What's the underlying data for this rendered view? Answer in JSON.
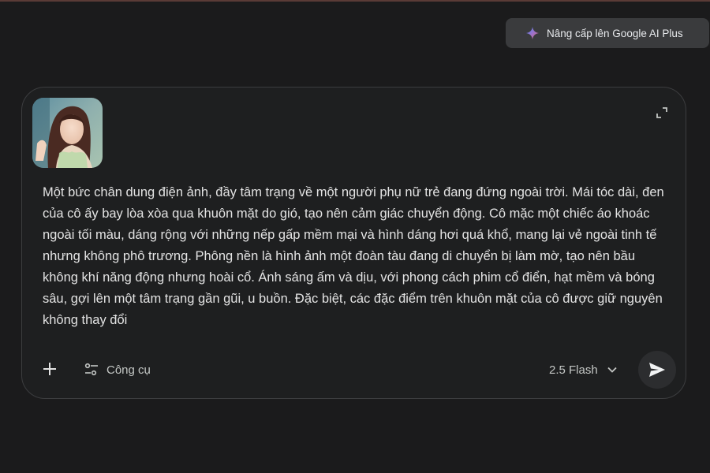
{
  "header": {
    "upgrade_label": "Nâng cấp lên Google AI Plus",
    "upgrade_icon": "gemini-sparkle-icon"
  },
  "prompt_card": {
    "attachment_icon": "image-thumbnail",
    "expand_icon": "expand-icon",
    "prompt_text": "Một bức chân dung điện ảnh, đầy tâm trạng về một người phụ nữ trẻ đang đứng ngoài trời. Mái tóc dài, đen của cô ấy bay lòa xòa qua khuôn mặt do gió, tạo nên cảm giác chuyển động. Cô mặc một chiếc áo khoác ngoài tối màu, dáng rộng với những nếp gấp mềm mại và hình dáng hơi quá khổ, mang lại vẻ ngoài tinh tế nhưng không phô trương. Phông nền là hình ảnh một đoàn tàu đang di chuyển bị làm mờ, tạo nên bầu không khí năng động nhưng hoài cổ. Ánh sáng ấm và dịu, với phong cách phim cổ điển, hạt mềm và bóng sâu, gợi lên một tâm trạng gần gũi, u buồn. Đặc biệt, các đặc điểm trên khuôn mặt của cô được giữ nguyên không thay đổi"
  },
  "toolbar": {
    "add_icon": "plus-icon",
    "tools_label": "Công cụ",
    "tools_icon": "tune-icon",
    "model_label": "2.5 Flash",
    "model_icon": "chevron-down-icon",
    "send_icon": "send-icon"
  },
  "colors": {
    "background": "#1b1b1c",
    "card": "#1e1f20",
    "upgrade_button": "#3a3b3d",
    "send_button": "#2c2d2f",
    "text": "#e3e3e3"
  }
}
